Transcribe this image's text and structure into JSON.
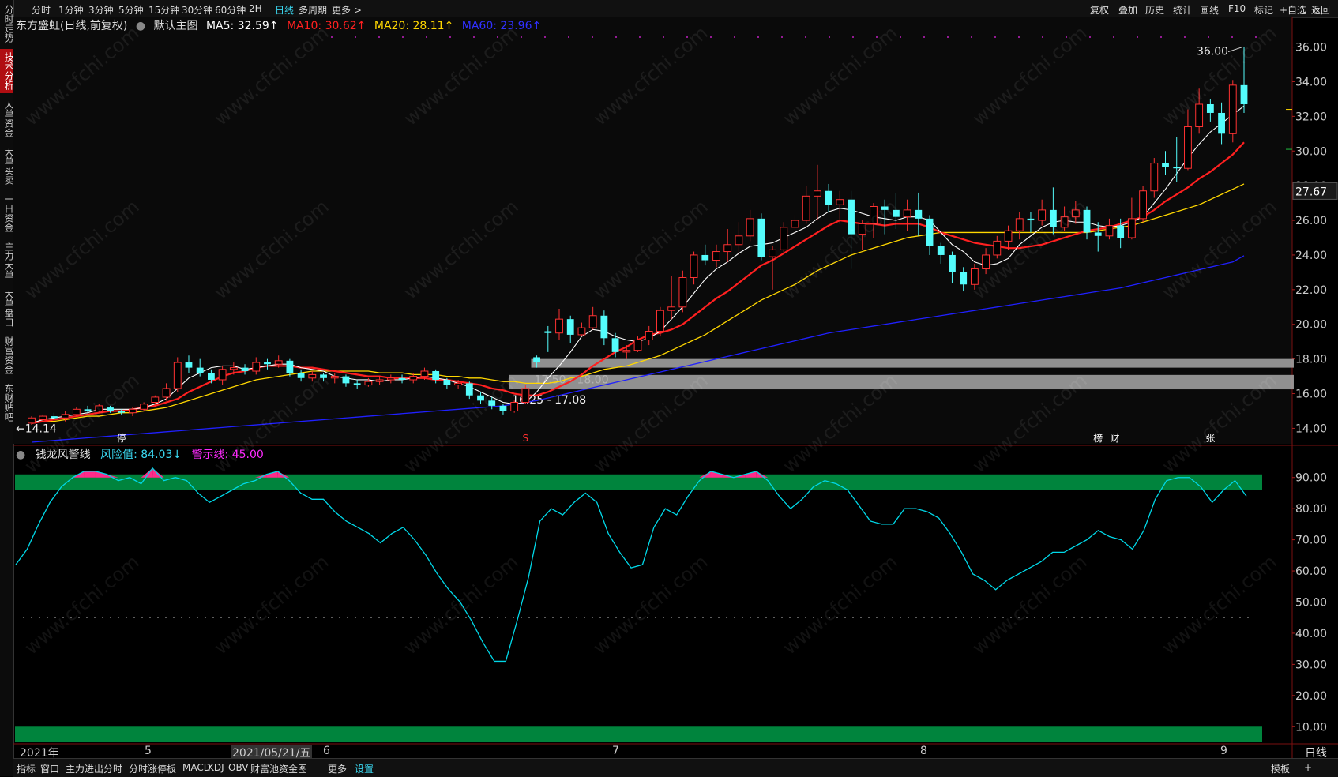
{
  "toolbar": {
    "periods": [
      "分时",
      "1分钟",
      "3分钟",
      "5分钟",
      "15分钟",
      "30分钟",
      "60分钟",
      "2H",
      "日线",
      "多周期",
      "更多 >"
    ],
    "active_period": "日线",
    "right_tools": [
      "复权",
      "叠加",
      "历史",
      "统计",
      "画线",
      "F10",
      "标记",
      "+自选",
      "返回"
    ]
  },
  "sidebar": {
    "tabs": [
      "分时走势",
      "技术分析",
      "大单资金",
      "大单买卖",
      "一日资金",
      "主力大单",
      "大单盘口",
      "财富资金",
      "东财贴吧"
    ],
    "active_tab": "技术分析"
  },
  "main_header": {
    "stock_name": "东方盛虹(日线,前复权)",
    "template": "默认主图",
    "ma5": "MA5: 32.59↑",
    "ma10": "MA10: 30.62↑",
    "ma20": "MA20: 28.11↑",
    "ma60": "MA60: 23.96↑"
  },
  "sub_header": {
    "indicator_name": "钱龙风警线",
    "risk": "风险值: 84.03↓",
    "warning": "警示线: 45.00"
  },
  "annotations": {
    "high": "36.00",
    "low": "←14.14",
    "current_price": "27.67",
    "box1": "17.50 - 18.00",
    "box2": "16.25 - 17.08",
    "marker_ting": "停",
    "marker_s": "S",
    "marker_bang": "榜",
    "marker_cai": "财",
    "marker_zhang": "张"
  },
  "date_axis": {
    "labels": [
      "2021年",
      "5",
      "2021/05/21/五",
      "6",
      "7",
      "8",
      "9"
    ],
    "period_label": "日线"
  },
  "bottom_bar": {
    "tabs": [
      "指标",
      "窗口",
      "主力进出分时",
      "分时涨停板",
      "MACD",
      "KDJ",
      "OBV",
      "财富池资金图",
      "更多",
      "设置"
    ],
    "right": [
      "模板",
      "+",
      "-"
    ]
  },
  "colors": {
    "up": "#ff3232",
    "down": "#54fcfc",
    "ma5": "#ffffff",
    "ma10": "#ff2020",
    "ma20": "#ffd700",
    "ma60": "#2020ff",
    "band": "#00843d",
    "risk_line": "#00d8e8",
    "overshoot": "#ff2a8a",
    "accent": "#3ad7f0"
  },
  "chart_data": [
    {
      "type": "candlestick",
      "title": "东方盛虹(日线,前复权)",
      "y_axis_ticks": [
        "36.00",
        "34.00",
        "32.00",
        "30.00",
        "28.00",
        "26.00",
        "24.00",
        "22.00",
        "20.00",
        "18.00",
        "16.00",
        "14.00"
      ],
      "ylim": [
        13.2,
        36.8
      ],
      "candles": [
        [
          14.3,
          14.6,
          14.2,
          14.7
        ],
        [
          14.5,
          14.7,
          14.4,
          14.8
        ],
        [
          14.7,
          14.6,
          14.5,
          14.9
        ],
        [
          14.6,
          14.8,
          14.4,
          15.0
        ],
        [
          14.8,
          15.1,
          14.7,
          15.2
        ],
        [
          15.1,
          15.0,
          14.9,
          15.3
        ],
        [
          15.0,
          15.3,
          14.9,
          15.4
        ],
        [
          15.2,
          15.0,
          14.9,
          15.3
        ],
        [
          15.0,
          14.9,
          14.8,
          15.1
        ],
        [
          14.9,
          15.1,
          14.7,
          15.2
        ],
        [
          15.1,
          15.4,
          15.0,
          15.5
        ],
        [
          15.5,
          15.8,
          15.3,
          15.9
        ],
        [
          15.8,
          16.3,
          15.6,
          16.6
        ],
        [
          16.3,
          17.8,
          16.1,
          18.1
        ],
        [
          17.8,
          17.5,
          17.2,
          18.2
        ],
        [
          17.5,
          17.2,
          17.0,
          18.0
        ],
        [
          17.2,
          16.8,
          16.6,
          17.4
        ],
        [
          16.8,
          17.4,
          16.5,
          17.6
        ],
        [
          17.4,
          17.5,
          17.1,
          17.8
        ],
        [
          17.5,
          17.3,
          17.1,
          17.7
        ],
        [
          17.3,
          17.8,
          17.1,
          18.1
        ],
        [
          17.8,
          17.7,
          17.4,
          18.0
        ],
        [
          17.7,
          17.9,
          17.5,
          18.2
        ],
        [
          17.9,
          17.2,
          17.0,
          18.0
        ],
        [
          17.2,
          16.9,
          16.7,
          17.4
        ],
        [
          16.9,
          17.1,
          16.7,
          17.3
        ],
        [
          17.1,
          16.9,
          16.7,
          17.2
        ],
        [
          16.9,
          17.0,
          16.6,
          17.2
        ],
        [
          17.0,
          16.6,
          16.4,
          17.1
        ],
        [
          16.6,
          16.5,
          16.3,
          16.8
        ],
        [
          16.5,
          16.7,
          16.4,
          16.9
        ],
        [
          16.7,
          16.8,
          16.5,
          17.0
        ],
        [
          16.8,
          16.9,
          16.6,
          17.1
        ],
        [
          16.9,
          16.8,
          16.6,
          17.1
        ],
        [
          16.8,
          17.0,
          16.6,
          17.2
        ],
        [
          17.0,
          17.3,
          16.8,
          17.5
        ],
        [
          17.3,
          16.8,
          16.6,
          17.4
        ],
        [
          16.8,
          16.5,
          16.3,
          16.9
        ],
        [
          16.5,
          16.6,
          16.3,
          16.8
        ],
        [
          16.6,
          15.9,
          15.7,
          16.7
        ],
        [
          15.9,
          15.6,
          15.4,
          16.1
        ],
        [
          15.6,
          15.3,
          15.1,
          15.8
        ],
        [
          15.3,
          15.0,
          14.8,
          15.4
        ],
        [
          15.0,
          15.5,
          14.9,
          15.6
        ],
        [
          15.5,
          16.3,
          15.4,
          16.5
        ],
        [
          18.1,
          17.8,
          17.5,
          18.2
        ],
        [
          19.6,
          19.5,
          18.4,
          19.9
        ],
        [
          19.5,
          20.3,
          19.1,
          20.9
        ],
        [
          20.3,
          19.4,
          18.9,
          20.5
        ],
        [
          19.4,
          19.8,
          19.3,
          20.1
        ],
        [
          19.8,
          20.5,
          19.7,
          21.0
        ],
        [
          20.5,
          19.2,
          18.8,
          20.8
        ],
        [
          19.2,
          18.4,
          18.1,
          19.5
        ],
        [
          18.4,
          18.5,
          18.0,
          18.8
        ],
        [
          18.5,
          19.1,
          18.4,
          19.3
        ],
        [
          19.1,
          19.6,
          18.8,
          19.9
        ],
        [
          19.6,
          20.8,
          19.3,
          21.0
        ],
        [
          20.8,
          21.0,
          20.3,
          22.8
        ],
        [
          21.0,
          22.7,
          20.7,
          23.1
        ],
        [
          22.7,
          24.0,
          22.3,
          24.2
        ],
        [
          24.0,
          23.7,
          23.4,
          24.6
        ],
        [
          23.7,
          24.2,
          23.3,
          24.6
        ],
        [
          24.2,
          24.6,
          23.6,
          25.5
        ],
        [
          24.6,
          25.1,
          24.0,
          25.9
        ],
        [
          25.1,
          26.1,
          24.8,
          26.6
        ],
        [
          26.1,
          23.9,
          23.7,
          26.4
        ],
        [
          23.9,
          24.3,
          22.0,
          24.5
        ],
        [
          24.3,
          25.6,
          24.1,
          25.9
        ],
        [
          25.6,
          26.0,
          25.1,
          26.3
        ],
        [
          26.0,
          27.4,
          25.8,
          28.0
        ],
        [
          27.4,
          27.7,
          26.0,
          29.2
        ],
        [
          27.7,
          26.9,
          26.5,
          28.1
        ],
        [
          26.9,
          27.2,
          25.8,
          27.7
        ],
        [
          27.2,
          25.2,
          23.2,
          27.7
        ],
        [
          25.2,
          25.8,
          24.3,
          26.0
        ],
        [
          25.8,
          26.8,
          25.0,
          27.0
        ],
        [
          26.8,
          26.6,
          25.2,
          27.2
        ],
        [
          26.6,
          26.2,
          25.5,
          27.6
        ],
        [
          26.2,
          26.6,
          25.4,
          27.2
        ],
        [
          26.6,
          26.1,
          25.1,
          27.6
        ],
        [
          26.1,
          24.5,
          24.0,
          26.3
        ],
        [
          24.5,
          24.0,
          23.5,
          24.7
        ],
        [
          24.0,
          23.0,
          22.4,
          24.2
        ],
        [
          23.0,
          22.3,
          21.9,
          23.3
        ],
        [
          22.3,
          23.2,
          22.0,
          23.5
        ],
        [
          23.2,
          24.0,
          22.9,
          24.4
        ],
        [
          24.0,
          24.8,
          23.8,
          25.1
        ],
        [
          24.8,
          25.4,
          24.3,
          25.7
        ],
        [
          25.4,
          26.1,
          24.9,
          26.5
        ],
        [
          26.1,
          26.0,
          25.3,
          26.5
        ],
        [
          26.0,
          26.6,
          25.7,
          27.2
        ],
        [
          26.6,
          25.6,
          25.2,
          27.9
        ],
        [
          25.6,
          26.2,
          25.4,
          26.8
        ],
        [
          26.2,
          26.6,
          25.8,
          27.1
        ],
        [
          26.6,
          25.3,
          24.9,
          26.8
        ],
        [
          25.3,
          25.1,
          24.2,
          25.9
        ],
        [
          25.1,
          25.7,
          24.9,
          26.1
        ],
        [
          25.7,
          25.0,
          24.4,
          26.1
        ],
        [
          25.0,
          26.1,
          24.9,
          27.3
        ],
        [
          26.1,
          27.7,
          25.9,
          28.0
        ],
        [
          27.7,
          29.3,
          27.3,
          29.6
        ],
        [
          29.3,
          29.1,
          28.6,
          30.0
        ],
        [
          29.1,
          29.0,
          28.2,
          30.8
        ],
        [
          29.0,
          31.4,
          28.9,
          32.4
        ],
        [
          31.4,
          32.7,
          31.0,
          33.6
        ],
        [
          32.7,
          32.2,
          31.7,
          33.0
        ],
        [
          32.2,
          31.0,
          30.4,
          32.8
        ],
        [
          31.0,
          33.8,
          30.5,
          34.1
        ],
        [
          33.8,
          32.7,
          32.2,
          36.0
        ]
      ],
      "ma5": [
        14.3,
        14.5,
        14.6,
        14.7,
        14.8,
        14.9,
        15.1,
        15.1,
        15.1,
        15.1,
        15.2,
        15.4,
        15.7,
        16.3,
        16.9,
        17.2,
        17.5,
        17.6,
        17.6,
        17.4,
        17.5,
        17.6,
        17.7,
        17.7,
        17.5,
        17.4,
        17.3,
        17.0,
        16.9,
        16.8,
        16.8,
        16.7,
        16.8,
        16.8,
        16.9,
        17.0,
        16.9,
        16.8,
        16.6,
        16.4,
        16.1,
        15.8,
        15.5,
        15.4,
        15.5,
        16.1,
        16.9,
        17.6,
        18.4,
        19.3,
        19.7,
        19.6,
        19.3,
        19.1,
        19.0,
        19.2,
        19.6,
        20.3,
        21.0,
        21.8,
        22.6,
        23.2,
        23.6,
        24.1,
        24.5,
        24.6,
        24.7,
        25.0,
        25.3,
        25.6,
        26.1,
        26.5,
        26.7,
        26.6,
        26.4,
        26.2,
        26.1,
        26.0,
        26.2,
        26.2,
        26.0,
        25.3,
        24.6,
        24.2,
        23.6,
        23.4,
        23.5,
        23.8,
        24.6,
        25.1,
        25.6,
        25.9,
        26.0,
        25.9,
        25.9,
        25.7,
        25.6,
        25.7,
        25.9,
        26.2,
        27.0,
        27.8,
        28.7,
        29.6,
        30.4,
        31.1,
        31.6,
        32.1,
        32.6
      ],
      "ma10": [
        14.3,
        14.4,
        14.5,
        14.6,
        14.7,
        14.8,
        14.9,
        15.0,
        15.0,
        15.1,
        15.2,
        15.3,
        15.5,
        15.7,
        16.1,
        16.4,
        16.7,
        17.0,
        17.2,
        17.3,
        17.5,
        17.6,
        17.6,
        17.6,
        17.5,
        17.5,
        17.4,
        17.3,
        17.2,
        17.1,
        17.0,
        17.0,
        16.9,
        16.9,
        16.9,
        16.9,
        16.8,
        16.8,
        16.7,
        16.6,
        16.5,
        16.3,
        16.2,
        16.0,
        15.9,
        15.9,
        16.1,
        16.4,
        16.7,
        17.1,
        17.6,
        18.0,
        18.4,
        18.7,
        19.1,
        19.4,
        19.5,
        19.7,
        20.0,
        20.5,
        21.0,
        21.5,
        21.9,
        22.4,
        22.9,
        23.4,
        23.7,
        24.1,
        24.5,
        24.9,
        25.3,
        25.7,
        26.0,
        25.9,
        25.8,
        25.8,
        25.7,
        25.8,
        25.8,
        25.8,
        25.6,
        25.3,
        25.1,
        24.9,
        24.7,
        24.6,
        24.5,
        24.4,
        24.4,
        24.5,
        24.6,
        24.8,
        25.0,
        25.2,
        25.4,
        25.5,
        25.6,
        25.8,
        26.0,
        26.2,
        26.6,
        27.1,
        27.5,
        27.9,
        28.4,
        28.8,
        29.3,
        29.8,
        30.5
      ],
      "ma20": [
        14.3,
        14.4,
        14.4,
        14.5,
        14.6,
        14.7,
        14.7,
        14.8,
        14.9,
        14.9,
        15.0,
        15.1,
        15.2,
        15.4,
        15.6,
        15.8,
        16.0,
        16.2,
        16.4,
        16.6,
        16.8,
        16.9,
        17.0,
        17.1,
        17.2,
        17.3,
        17.3,
        17.3,
        17.3,
        17.3,
        17.3,
        17.2,
        17.2,
        17.2,
        17.1,
        17.1,
        17.1,
        17.0,
        17.0,
        16.9,
        16.9,
        16.8,
        16.7,
        16.7,
        16.6,
        16.6,
        16.6,
        16.7,
        16.9,
        17.0,
        17.2,
        17.4,
        17.5,
        17.6,
        17.8,
        18.0,
        18.2,
        18.5,
        18.8,
        19.1,
        19.4,
        19.8,
        20.2,
        20.6,
        21.0,
        21.4,
        21.7,
        22.0,
        22.3,
        22.7,
        23.1,
        23.4,
        23.7,
        24.0,
        24.2,
        24.4,
        24.6,
        24.8,
        25.0,
        25.1,
        25.2,
        25.3,
        25.3,
        25.3,
        25.3,
        25.3,
        25.3,
        25.3,
        25.3,
        25.3,
        25.3,
        25.3,
        25.3,
        25.3,
        25.3,
        25.4,
        25.5,
        25.6,
        25.7,
        25.9,
        26.1,
        26.3,
        26.5,
        26.7,
        26.9,
        27.2,
        27.5,
        27.8,
        28.1
      ],
      "ma60": [
        13.2,
        13.25,
        13.3,
        13.35,
        13.4,
        13.45,
        13.5,
        13.55,
        13.6,
        13.65,
        13.7,
        13.75,
        13.8,
        13.85,
        13.9,
        13.95,
        14.0,
        14.05,
        14.1,
        14.15,
        14.2,
        14.25,
        14.3,
        14.35,
        14.4,
        14.45,
        14.5,
        14.55,
        14.6,
        14.65,
        14.7,
        14.75,
        14.8,
        14.85,
        14.9,
        14.95,
        15.0,
        15.05,
        15.1,
        15.15,
        15.2,
        15.25,
        15.3,
        15.4,
        15.5,
        15.6,
        15.75,
        15.9,
        16.05,
        16.2,
        16.35,
        16.5,
        16.65,
        16.8,
        16.95,
        17.1,
        17.25,
        17.4,
        17.55,
        17.7,
        17.85,
        18.0,
        18.15,
        18.3,
        18.45,
        18.6,
        18.75,
        18.9,
        19.05,
        19.2,
        19.35,
        19.5,
        19.6,
        19.7,
        19.8,
        19.9,
        20.0,
        20.1,
        20.2,
        20.3,
        20.4,
        20.5,
        20.6,
        20.7,
        20.8,
        20.9,
        21.0,
        21.1,
        21.2,
        21.3,
        21.4,
        21.5,
        21.6,
        21.7,
        21.8,
        21.9,
        22.0,
        22.1,
        22.25,
        22.4,
        22.55,
        22.7,
        22.85,
        23.0,
        23.15,
        23.3,
        23.45,
        23.6,
        23.96
      ],
      "zones": [
        {
          "label": "17.50 - 18.00",
          "from": 17.5,
          "to": 18.0
        },
        {
          "label": "16.25 - 17.08",
          "from": 16.25,
          "to": 17.08
        }
      ],
      "high_annotation": 36.0,
      "low_annotation": 14.14,
      "current_price": 27.67
    },
    {
      "type": "line",
      "title": "钱龙风警线",
      "y_axis_ticks": [
        "90.00",
        "80.00",
        "70.00",
        "60.00",
        "50.00",
        "40.00",
        "30.00",
        "20.00",
        "10.00"
      ],
      "ylim": [
        5,
        95
      ],
      "bands": [
        {
          "from": 86,
          "to": 91
        },
        {
          "from": 5,
          "to": 10
        }
      ],
      "warning_level": 45,
      "risk_values": [
        62,
        67,
        75,
        82,
        87,
        90,
        92,
        92,
        91,
        89,
        90,
        88,
        93,
        89,
        90,
        89,
        85,
        82,
        84,
        86,
        88,
        89,
        91,
        92,
        89,
        85,
        83,
        83,
        79,
        76,
        74,
        72,
        69,
        72,
        74,
        70,
        65,
        59,
        54,
        50,
        44,
        37,
        31,
        31,
        44,
        58,
        76,
        80,
        78,
        82,
        85,
        82,
        72,
        66,
        61,
        62,
        74,
        80,
        78,
        84,
        89,
        92,
        91,
        90,
        91,
        92,
        89,
        84,
        80,
        83,
        87,
        89,
        88,
        86,
        81,
        76,
        75,
        75,
        80,
        80,
        79,
        77,
        72,
        66,
        59,
        57,
        54,
        57,
        59,
        61,
        63,
        66,
        66,
        68,
        70,
        73,
        71,
        70,
        67,
        73,
        83,
        89,
        90,
        90,
        87,
        82,
        86,
        89,
        84
      ]
    }
  ]
}
